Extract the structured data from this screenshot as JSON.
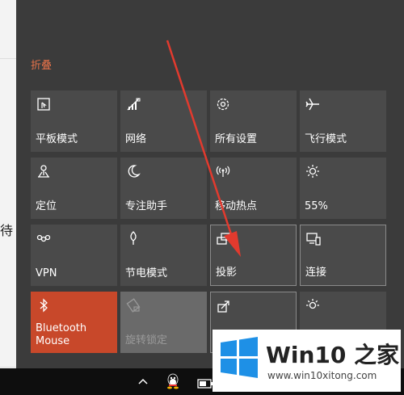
{
  "background": {
    "partial_text": "待"
  },
  "action_center": {
    "collapse_label": "折叠",
    "tiles": [
      {
        "label": "平板模式",
        "icon": "tablet-mode-icon"
      },
      {
        "label": "网络",
        "icon": "network-icon"
      },
      {
        "label": "所有设置",
        "icon": "settings-gear-icon"
      },
      {
        "label": "飞行模式",
        "icon": "airplane-icon"
      },
      {
        "label": "定位",
        "icon": "location-icon"
      },
      {
        "label": "专注助手",
        "icon": "moon-icon"
      },
      {
        "label": "移动热点",
        "icon": "hotspot-icon"
      },
      {
        "label": "55%",
        "icon": "brightness-icon"
      },
      {
        "label": "VPN",
        "icon": "vpn-icon"
      },
      {
        "label": "节电模式",
        "icon": "battery-saver-icon"
      },
      {
        "label": "投影",
        "icon": "project-icon"
      },
      {
        "label": "连接",
        "icon": "connect-icon"
      },
      {
        "label": "Bluetooth Mouse",
        "icon": "bluetooth-icon"
      },
      {
        "label": "旋转锁定",
        "icon": "rotation-lock-icon"
      },
      {
        "label": "",
        "icon": "share-icon"
      },
      {
        "label": "",
        "icon": "night-light-icon"
      }
    ]
  },
  "taskbar": {
    "icons": [
      "chevron-up-icon",
      "qq-icon",
      "battery-icon"
    ]
  },
  "watermark": {
    "title": "Win10 之家",
    "url": "www.win10xitong.com"
  },
  "colors": {
    "accent": "#c8482a",
    "tile": "#4a4a4a",
    "panel": "#3b3b3b",
    "link": "#e8734a"
  }
}
